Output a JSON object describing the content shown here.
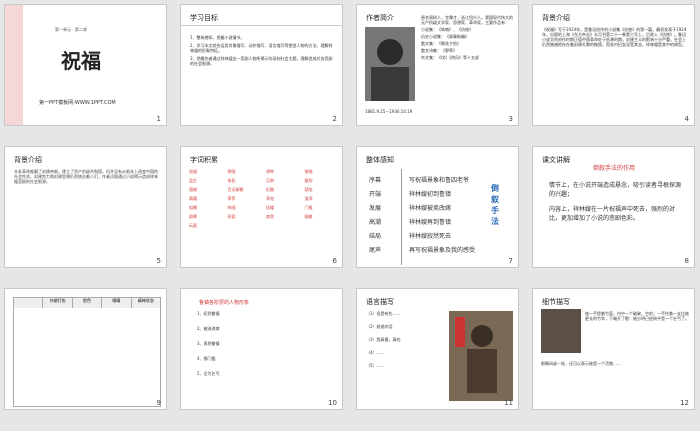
{
  "slides": [
    {
      "num": "1",
      "top_label": "第一单元 · 第二课",
      "title": "祝福",
      "footer": "第一PPT模板网-WWW.1PPT.COM"
    },
    {
      "num": "2",
      "title": "学习目标",
      "items": [
        "1、整体感知，把握小说情节。",
        "2、学习本文综合运用肖像描写、动作描写、语言描写等塑造人物的方法，理解祥林嫂的形象特征。",
        "3、把握作者通过祥林嫂这一悲剧人物所揭示的深刻社会主题，理解造成任务悲剧的社会根源。"
      ]
    },
    {
      "num": "3",
      "title": "作者简介",
      "lines": [
        "原名周树人，字豫才，浙江绍兴人。我国现代伟大的无产阶级文学家、思想家、革命家。主要作品有：",
        "小说集：《呐喊》、《彷徨》",
        "历史小说集：《故事新编》",
        "散文集：《朝花夕拾》",
        "散文诗集：《野草》",
        "杂文集：《坟》《热风》等十五部"
      ],
      "dates": "1881.9.25－1936.10.19"
    },
    {
      "num": "4",
      "title": "背景介绍",
      "para": "《祝福》写于1924年，是鲁迅创作的小说集《彷徨》的第一篇，最初发表于1924年，出版的上海《东方杂志》半月刊第二十一卷第六号上，后收入《彷徨》。鲁迅小说文的创作时期正值中国革命处于低潮时期，封建主义的影响十分严重，社会上仍然普遍地存在着封建礼教的枷锁，而农村妇女深受其苦，祥林嫂是其中的典型。"
    },
    {
      "num": "5",
      "title": "背景介绍",
      "para": "辛亥革命推翻了封建帝制，建立了资产阶级共和国，但并没有从根本上改变中国的社会性质，封建势力和封建思想仍然统治着人们，作者试图通过小说揭示造成祥林嫂悲剧的社会根源。"
    },
    {
      "num": "6",
      "title": "字词积累",
      "words": [
        "祝福",
        "寒暄",
        "谬种",
        "惴惴",
        "监生",
        "朱拓",
        "沉寂",
        "瘦削",
        "蹙缩",
        "百无聊赖",
        "形骸",
        "窈陷",
        "踌躇",
        "荸荠",
        "乖觉",
        "渣滓",
        "咀嚼",
        "呜咽",
        "炫耀",
        "门槛",
        "赔罪",
        "形容",
        "寂然",
        "顺着",
        "玩意"
      ]
    },
    {
      "num": "7",
      "title": "整体感知",
      "rows": [
        [
          "序幕",
          "写祝福景象和鲁四老爷"
        ],
        [
          "开端",
          "祥林嫂初到鲁镇"
        ],
        [
          "发展",
          "祥林嫂被卖改嫁"
        ],
        [
          "高潮",
          "祥林嫂再到鲁镇"
        ],
        [
          "结局",
          "祥林嫂寂然死去"
        ],
        [
          "尾声",
          "再写祝福景象及我的感受"
        ]
      ],
      "side": "倒叙手法"
    },
    {
      "num": "8",
      "title": "课文讲解",
      "subtitle": "倒叙手法的作用",
      "points": [
        "情节上，在小说开端造成悬念，吸引读者寻根探源的兴趣；",
        "内容上，祥林嫂在一片祝福声中死去，强烈的对比，更加增加了小说的悲剧色彩。"
      ]
    },
    {
      "num": "9",
      "title": "",
      "table": [
        [
          "",
          "外貌打扮",
          "脸色",
          "眼睛",
          "精神状态"
        ]
      ]
    },
    {
      "num": "10",
      "title": "",
      "heading": "鲁镇各阶层的人物形象",
      "items": [
        "1、初到鲁镇",
        "2、被迫改嫁",
        "3、再到鲁镇",
        "4、捐门槛",
        "5、沦为乞丐"
      ]
    },
    {
      "num": "11",
      "title": "语言描写",
      "items": [
        "（1）但是有些……",
        "（2）她说的话",
        "（3）我真傻，真的",
        "（4）……",
        "（5）……"
      ]
    },
    {
      "num": "12",
      "title": "细节描写",
      "para": "她一手提着竹篮，内中一个破碗，空的；一手拄着一支比她更长的竹竿，下端开了裂：她分明已经纯乎是一个乞丐了。",
      "para2": "眼睛间或一轮，还可以表示她是一个活物……"
    }
  ]
}
